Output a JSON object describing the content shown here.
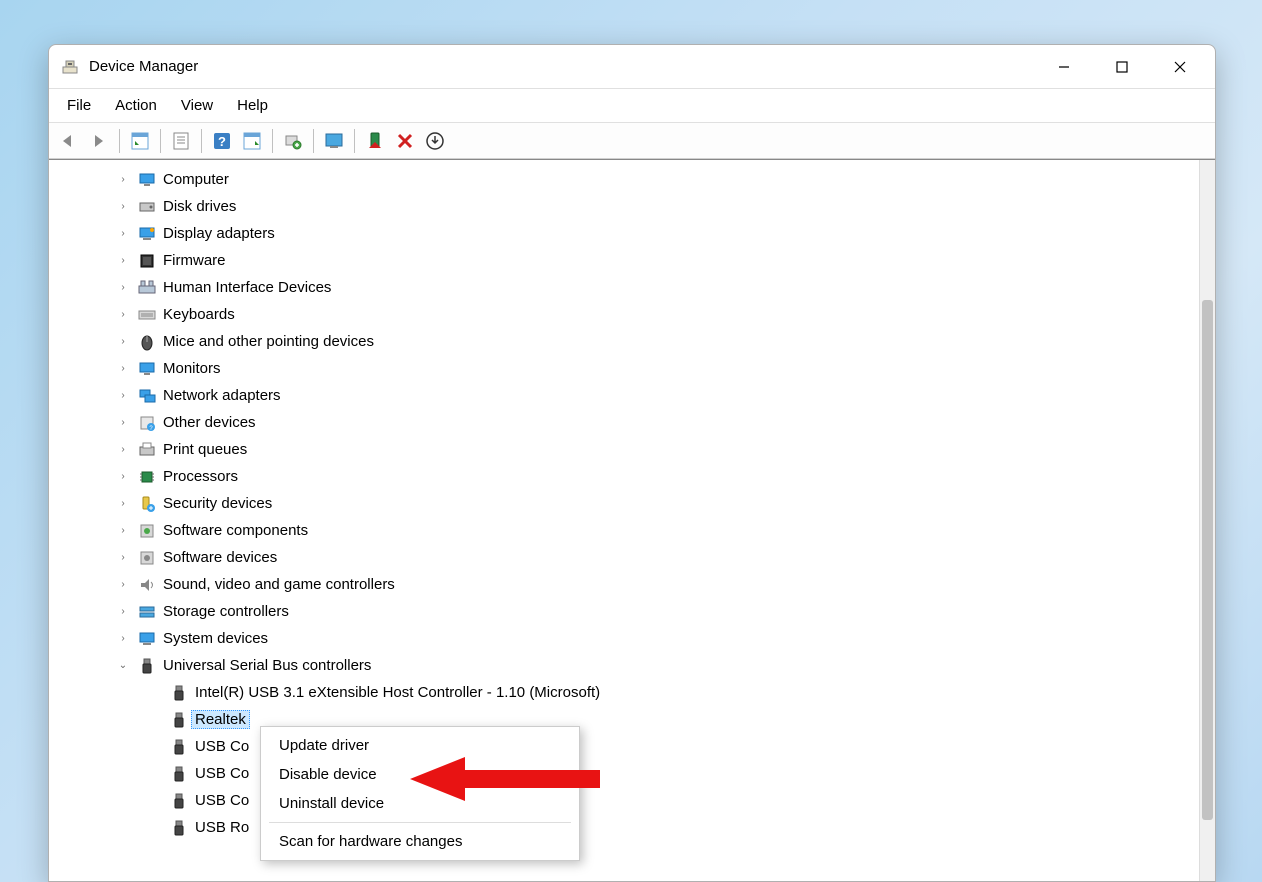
{
  "window": {
    "title": "Device Manager"
  },
  "menus": {
    "file": "File",
    "action": "Action",
    "view": "View",
    "help": "Help"
  },
  "toolbar_icons": {
    "back": "back-icon",
    "forward": "forward-icon",
    "show_hide": "show-hide-tree-icon",
    "properties": "properties-icon",
    "help": "help-icon",
    "details": "details-icon",
    "scan": "scan-hardware-icon",
    "monitor": "monitor-action-icon",
    "enable": "enable-device-icon",
    "disable": "disable-device-icon",
    "uninstall": "uninstall-icon"
  },
  "tree": {
    "items": [
      {
        "label": "Computer",
        "icon": "computer-icon"
      },
      {
        "label": "Disk drives",
        "icon": "disk-icon"
      },
      {
        "label": "Display adapters",
        "icon": "display-adapter-icon"
      },
      {
        "label": "Firmware",
        "icon": "firmware-icon"
      },
      {
        "label": "Human Interface Devices",
        "icon": "hid-icon"
      },
      {
        "label": "Keyboards",
        "icon": "keyboard-icon"
      },
      {
        "label": "Mice and other pointing devices",
        "icon": "mouse-icon"
      },
      {
        "label": "Monitors",
        "icon": "monitor-icon"
      },
      {
        "label": "Network adapters",
        "icon": "network-icon"
      },
      {
        "label": "Other devices",
        "icon": "other-device-icon"
      },
      {
        "label": "Print queues",
        "icon": "print-queue-icon"
      },
      {
        "label": "Processors",
        "icon": "processor-icon"
      },
      {
        "label": "Security devices",
        "icon": "security-icon"
      },
      {
        "label": "Software components",
        "icon": "software-component-icon"
      },
      {
        "label": "Software devices",
        "icon": "software-device-icon"
      },
      {
        "label": "Sound, video and game controllers",
        "icon": "sound-icon"
      },
      {
        "label": "Storage controllers",
        "icon": "storage-icon"
      },
      {
        "label": "System devices",
        "icon": "system-device-icon"
      },
      {
        "label": "Universal Serial Bus controllers",
        "icon": "usb-controller-icon",
        "expanded": true
      }
    ],
    "usb_children": [
      {
        "label": "Intel(R) USB 3.1 eXtensible Host Controller - 1.10 (Microsoft)",
        "icon": "usb-icon"
      },
      {
        "label": "Realtek",
        "icon": "usb-icon",
        "selected": true
      },
      {
        "label": "USB Co",
        "icon": "usb-icon"
      },
      {
        "label": "USB Co",
        "icon": "usb-icon"
      },
      {
        "label": "USB Co",
        "icon": "usb-icon"
      },
      {
        "label": "USB Ro",
        "icon": "usb-icon"
      }
    ]
  },
  "context_menu": {
    "items": [
      "Update driver",
      "Disable device",
      "Uninstall device",
      "---",
      "Scan for hardware changes"
    ]
  }
}
